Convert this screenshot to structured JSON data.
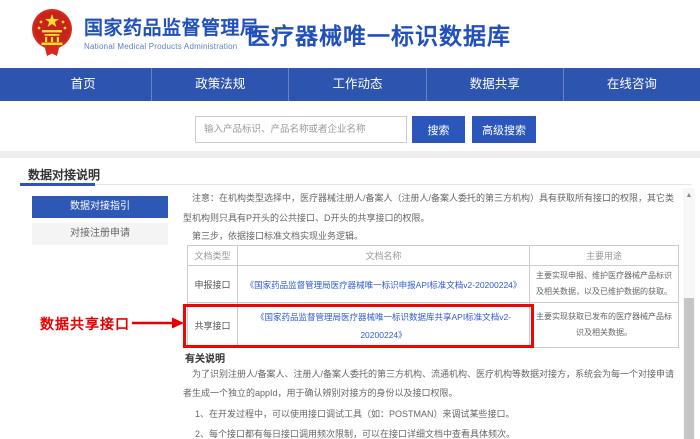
{
  "header": {
    "agency_cn": "国家药品监督管理局",
    "agency_en": "National Medical Products  Administration",
    "site_title": "医疗器械唯一标识数据库"
  },
  "nav": {
    "items": [
      "首页",
      "政策法规",
      "工作动态",
      "数据共享",
      "在线咨询"
    ]
  },
  "search": {
    "placeholder": "输入产品标识、产品名称或者企业名称",
    "search_label": "搜索",
    "advanced_label": "高级搜索"
  },
  "section": {
    "title": "数据对接说明"
  },
  "sidebar": {
    "items": [
      {
        "label": "数据对接指引",
        "active": true
      },
      {
        "label": "对接注册申请",
        "active": false
      }
    ]
  },
  "content": {
    "note": "注意：在机构类型选择中，医疗器械注册人/备案人（注册人/备案人委托的第三方机构）具有获取所有接口的权限，其它类型机构则只具有P开头的公共接口、D开头的共享接口的权限。",
    "step3": "第三步，依据接口标准文档实现业务逻辑。",
    "table": {
      "headers": [
        "文档类型",
        "文档名称",
        "主要用途"
      ],
      "rows": [
        {
          "type": "申报接口",
          "doc": "《国家药品监督管理局医疗器械唯一标识申报API标准文档v2-20200224》",
          "purpose": "主要实现申报、维护医疗器械产品标识及相关数据，以及已维护数据的获取。"
        },
        {
          "type": "共享接口",
          "doc": "《国家药品监督管理局医疗器械唯一标识数据库共享API标准文档v2-20200224》",
          "purpose": "主要实现获取已发布的医疗器械产品标识及相关数据。"
        }
      ]
    },
    "annotation": {
      "label": "数据共享接口"
    },
    "notes_title": "有关说明",
    "notes_para": "为了识别注册人/备案人、注册人/备案人委托的第三方机构、流通机构、医疗机构等数据对接方，系统会为每一个对接申请者生成一个独立的appId，用于确认辨别对接方的身份以及接口权限。",
    "note1": "1、在开发过程中，可以使用接口调试工具（如：POSTMAN）来调试某些接口。",
    "note2": "2、每个接口都有每日接口调用频次限制，可以在接口详细文档中查看具体频次。"
  },
  "icons": {
    "scroll_up": "▲"
  },
  "colors": {
    "nav_blue": "#2d54ae",
    "button_blue": "#2b57bd",
    "title_blue": "#2150bd",
    "link_blue": "#2f5bd7",
    "annotation_red": "#e60000"
  }
}
